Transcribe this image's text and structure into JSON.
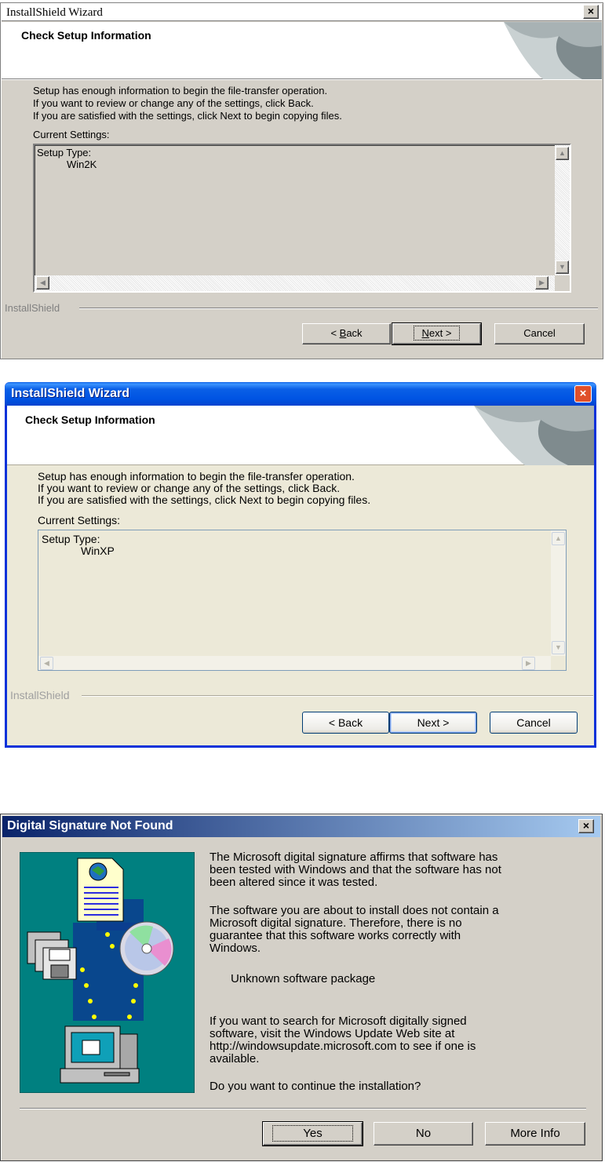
{
  "dialog_2k": {
    "title": "InstallShield Wizard",
    "close_glyph": "×",
    "header_title": "Check Setup Information",
    "intro_lines": [
      "Setup has enough information to begin the file-transfer operation.",
      "If you want to review or change any of the settings, click Back.",
      "If you are satisfied with the settings, click Next to begin copying files."
    ],
    "current_settings_label": "Current Settings:",
    "setup_type_label": "Setup Type:",
    "setup_type_value": "Win2K",
    "brand": "InstallShield",
    "back_prefix": "< ",
    "back_mnemonic": "B",
    "back_rest": "ack",
    "next_mnemonic": "N",
    "next_rest": "ext >",
    "cancel_label": "Cancel"
  },
  "dialog_xp": {
    "title": "InstallShield Wizard",
    "close_glyph": "×",
    "header_title": "Check Setup Information",
    "intro_lines": [
      "Setup has enough information to begin the file-transfer operation.",
      "If you want to review or change any of the settings, click Back.",
      "If you are satisfied with the settings, click Next to begin copying files."
    ],
    "current_settings_label": "Current Settings:",
    "setup_type_label": "Setup Type:",
    "setup_type_value": "WinXP",
    "brand": "InstallShield",
    "back_label": "< Back",
    "next_label": "Next >",
    "cancel_label": "Cancel"
  },
  "signature_dialog": {
    "title": "Digital Signature Not Found",
    "close_glyph": "×",
    "para1": [
      "The Microsoft digital signature affirms that software has",
      "been tested with Windows and that the software has not",
      "been altered since it was tested."
    ],
    "para2": [
      "The software you are about to install does not contain a",
      "Microsoft digital signature. Therefore,  there is no",
      "guarantee that this software works correctly with",
      "Windows."
    ],
    "package_name": "Unknown software package",
    "para3": [
      "If you want to search for Microsoft digitally signed",
      "software, visit the Windows Update Web site at",
      "http://windowsupdate.microsoft.com to see if one is",
      "available."
    ],
    "question": "Do you want to continue the installation?",
    "yes_label": "Yes",
    "no_label": "No",
    "more_info_label": "More Info"
  },
  "colors": {
    "win2k_face": "#d4d0c8",
    "xp_face": "#ece9d8",
    "xp_title_blue": "#0054e3",
    "xp_close_red": "#e0502a",
    "classic_title_dark": "#0a246a",
    "illustration_teal": "#008080"
  },
  "icons": {
    "header_art": "curled-page-graphic",
    "signature_art": "document-cd-floppies-computer-illustration"
  }
}
